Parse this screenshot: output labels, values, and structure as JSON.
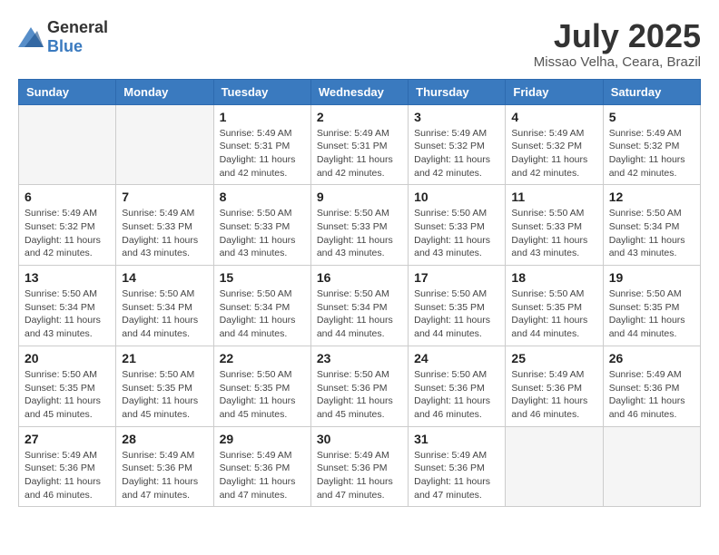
{
  "header": {
    "logo_general": "General",
    "logo_blue": "Blue",
    "month": "July 2025",
    "location": "Missao Velha, Ceara, Brazil"
  },
  "weekdays": [
    "Sunday",
    "Monday",
    "Tuesday",
    "Wednesday",
    "Thursday",
    "Friday",
    "Saturday"
  ],
  "weeks": [
    [
      {
        "day": "",
        "sunrise": "",
        "sunset": "",
        "daylight": ""
      },
      {
        "day": "",
        "sunrise": "",
        "sunset": "",
        "daylight": ""
      },
      {
        "day": "1",
        "sunrise": "Sunrise: 5:49 AM",
        "sunset": "Sunset: 5:31 PM",
        "daylight": "Daylight: 11 hours and 42 minutes."
      },
      {
        "day": "2",
        "sunrise": "Sunrise: 5:49 AM",
        "sunset": "Sunset: 5:31 PM",
        "daylight": "Daylight: 11 hours and 42 minutes."
      },
      {
        "day": "3",
        "sunrise": "Sunrise: 5:49 AM",
        "sunset": "Sunset: 5:32 PM",
        "daylight": "Daylight: 11 hours and 42 minutes."
      },
      {
        "day": "4",
        "sunrise": "Sunrise: 5:49 AM",
        "sunset": "Sunset: 5:32 PM",
        "daylight": "Daylight: 11 hours and 42 minutes."
      },
      {
        "day": "5",
        "sunrise": "Sunrise: 5:49 AM",
        "sunset": "Sunset: 5:32 PM",
        "daylight": "Daylight: 11 hours and 42 minutes."
      }
    ],
    [
      {
        "day": "6",
        "sunrise": "Sunrise: 5:49 AM",
        "sunset": "Sunset: 5:32 PM",
        "daylight": "Daylight: 11 hours and 42 minutes."
      },
      {
        "day": "7",
        "sunrise": "Sunrise: 5:49 AM",
        "sunset": "Sunset: 5:33 PM",
        "daylight": "Daylight: 11 hours and 43 minutes."
      },
      {
        "day": "8",
        "sunrise": "Sunrise: 5:50 AM",
        "sunset": "Sunset: 5:33 PM",
        "daylight": "Daylight: 11 hours and 43 minutes."
      },
      {
        "day": "9",
        "sunrise": "Sunrise: 5:50 AM",
        "sunset": "Sunset: 5:33 PM",
        "daylight": "Daylight: 11 hours and 43 minutes."
      },
      {
        "day": "10",
        "sunrise": "Sunrise: 5:50 AM",
        "sunset": "Sunset: 5:33 PM",
        "daylight": "Daylight: 11 hours and 43 minutes."
      },
      {
        "day": "11",
        "sunrise": "Sunrise: 5:50 AM",
        "sunset": "Sunset: 5:33 PM",
        "daylight": "Daylight: 11 hours and 43 minutes."
      },
      {
        "day": "12",
        "sunrise": "Sunrise: 5:50 AM",
        "sunset": "Sunset: 5:34 PM",
        "daylight": "Daylight: 11 hours and 43 minutes."
      }
    ],
    [
      {
        "day": "13",
        "sunrise": "Sunrise: 5:50 AM",
        "sunset": "Sunset: 5:34 PM",
        "daylight": "Daylight: 11 hours and 43 minutes."
      },
      {
        "day": "14",
        "sunrise": "Sunrise: 5:50 AM",
        "sunset": "Sunset: 5:34 PM",
        "daylight": "Daylight: 11 hours and 44 minutes."
      },
      {
        "day": "15",
        "sunrise": "Sunrise: 5:50 AM",
        "sunset": "Sunset: 5:34 PM",
        "daylight": "Daylight: 11 hours and 44 minutes."
      },
      {
        "day": "16",
        "sunrise": "Sunrise: 5:50 AM",
        "sunset": "Sunset: 5:34 PM",
        "daylight": "Daylight: 11 hours and 44 minutes."
      },
      {
        "day": "17",
        "sunrise": "Sunrise: 5:50 AM",
        "sunset": "Sunset: 5:35 PM",
        "daylight": "Daylight: 11 hours and 44 minutes."
      },
      {
        "day": "18",
        "sunrise": "Sunrise: 5:50 AM",
        "sunset": "Sunset: 5:35 PM",
        "daylight": "Daylight: 11 hours and 44 minutes."
      },
      {
        "day": "19",
        "sunrise": "Sunrise: 5:50 AM",
        "sunset": "Sunset: 5:35 PM",
        "daylight": "Daylight: 11 hours and 44 minutes."
      }
    ],
    [
      {
        "day": "20",
        "sunrise": "Sunrise: 5:50 AM",
        "sunset": "Sunset: 5:35 PM",
        "daylight": "Daylight: 11 hours and 45 minutes."
      },
      {
        "day": "21",
        "sunrise": "Sunrise: 5:50 AM",
        "sunset": "Sunset: 5:35 PM",
        "daylight": "Daylight: 11 hours and 45 minutes."
      },
      {
        "day": "22",
        "sunrise": "Sunrise: 5:50 AM",
        "sunset": "Sunset: 5:35 PM",
        "daylight": "Daylight: 11 hours and 45 minutes."
      },
      {
        "day": "23",
        "sunrise": "Sunrise: 5:50 AM",
        "sunset": "Sunset: 5:36 PM",
        "daylight": "Daylight: 11 hours and 45 minutes."
      },
      {
        "day": "24",
        "sunrise": "Sunrise: 5:50 AM",
        "sunset": "Sunset: 5:36 PM",
        "daylight": "Daylight: 11 hours and 46 minutes."
      },
      {
        "day": "25",
        "sunrise": "Sunrise: 5:49 AM",
        "sunset": "Sunset: 5:36 PM",
        "daylight": "Daylight: 11 hours and 46 minutes."
      },
      {
        "day": "26",
        "sunrise": "Sunrise: 5:49 AM",
        "sunset": "Sunset: 5:36 PM",
        "daylight": "Daylight: 11 hours and 46 minutes."
      }
    ],
    [
      {
        "day": "27",
        "sunrise": "Sunrise: 5:49 AM",
        "sunset": "Sunset: 5:36 PM",
        "daylight": "Daylight: 11 hours and 46 minutes."
      },
      {
        "day": "28",
        "sunrise": "Sunrise: 5:49 AM",
        "sunset": "Sunset: 5:36 PM",
        "daylight": "Daylight: 11 hours and 47 minutes."
      },
      {
        "day": "29",
        "sunrise": "Sunrise: 5:49 AM",
        "sunset": "Sunset: 5:36 PM",
        "daylight": "Daylight: 11 hours and 47 minutes."
      },
      {
        "day": "30",
        "sunrise": "Sunrise: 5:49 AM",
        "sunset": "Sunset: 5:36 PM",
        "daylight": "Daylight: 11 hours and 47 minutes."
      },
      {
        "day": "31",
        "sunrise": "Sunrise: 5:49 AM",
        "sunset": "Sunset: 5:36 PM",
        "daylight": "Daylight: 11 hours and 47 minutes."
      },
      {
        "day": "",
        "sunrise": "",
        "sunset": "",
        "daylight": ""
      },
      {
        "day": "",
        "sunrise": "",
        "sunset": "",
        "daylight": ""
      }
    ]
  ]
}
